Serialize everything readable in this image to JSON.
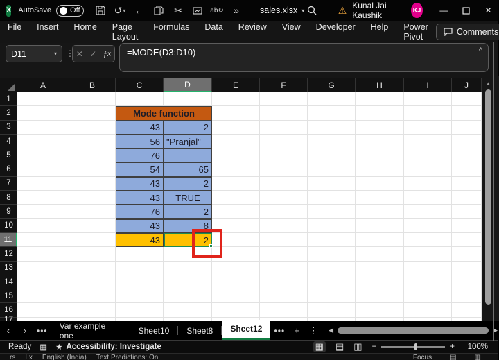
{
  "title_bar": {
    "app_name": "Excel",
    "autosave_label": "AutoSave",
    "autosave_state": "Off",
    "qat_icons": [
      {
        "name": "save-icon",
        "glyph": "save"
      },
      {
        "name": "undo-icon",
        "glyph": "undo",
        "has_dropdown": true
      },
      {
        "name": "back-arrow-icon",
        "glyph": "back"
      },
      {
        "name": "copy-icon",
        "glyph": "copy"
      },
      {
        "name": "cut-icon",
        "glyph": "cut"
      },
      {
        "name": "insert-picture-icon",
        "glyph": "picture"
      },
      {
        "name": "replace-icon",
        "glyph": "replace"
      },
      {
        "name": "more-commands-icon",
        "glyph": "overflow"
      }
    ],
    "document_name": "sales.xlsx",
    "user_name": "Kunal Jai Kaushik",
    "user_initials": "KJ"
  },
  "ribbon": {
    "tabs": [
      "File",
      "Insert",
      "Home",
      "Page Layout",
      "Formulas",
      "Data",
      "Review",
      "View",
      "Developer",
      "Help",
      "Power Pivot"
    ],
    "comments_label": "Comments"
  },
  "formula_bar": {
    "name_box_value": "D11",
    "formula": "=MODE(D3:D10)"
  },
  "grid": {
    "columns": [
      "A",
      "B",
      "C",
      "D",
      "E",
      "F",
      "G",
      "H",
      "I",
      "J"
    ],
    "visible_rows": 17,
    "selected_column": "D",
    "selected_row": 11,
    "table": {
      "header": "Mode function",
      "rows": [
        {
          "row": 3,
          "c": "43",
          "d": "2",
          "d_align": "right"
        },
        {
          "row": 4,
          "c": "56",
          "d": "\"Pranjal\"",
          "d_align": "left"
        },
        {
          "row": 5,
          "c": "76",
          "d": "",
          "d_align": "right"
        },
        {
          "row": 6,
          "c": "54",
          "d": "65",
          "d_align": "right"
        },
        {
          "row": 7,
          "c": "43",
          "d": "2",
          "d_align": "right"
        },
        {
          "row": 8,
          "c": "43",
          "d": "TRUE",
          "d_align": "center"
        },
        {
          "row": 9,
          "c": "76",
          "d": "2",
          "d_align": "right"
        },
        {
          "row": 10,
          "c": "43",
          "d": "8",
          "d_align": "right"
        },
        {
          "row": 11,
          "c": "43",
          "d": "2",
          "d_align": "right",
          "highlight": true
        }
      ]
    },
    "colors": {
      "table_header_fill": "#C45911",
      "data_fill": "#8EAADB",
      "highlight_fill": "#FFC000",
      "selection_green": "#1E8A52",
      "annotation_red": "#E0241B"
    }
  },
  "sheet_tabs": {
    "items": [
      "Var example one",
      "Sheet10",
      "Sheet8",
      "Sheet12"
    ],
    "active": "Sheet12"
  },
  "status_bar": {
    "mode": "Ready",
    "accessibility": "Accessibility: Investigate",
    "zoom_level": "100%"
  },
  "background_window_bar": {
    "left_fragment": "rs",
    "proofing": "Lx",
    "language": "English (India)",
    "text_predictions": "Text Predictions: On",
    "focus": "Focus"
  }
}
